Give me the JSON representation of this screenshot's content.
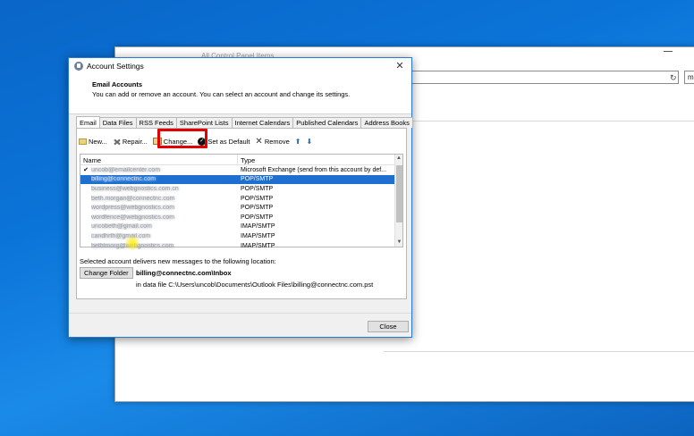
{
  "background_window": {
    "title": "All Control Panel Items",
    "search_text": "ma",
    "refresh_glyph": "↻"
  },
  "dialog": {
    "title": "Account Settings",
    "close_glyph": "✕",
    "header_title": "Email Accounts",
    "header_subtitle": "You can add or remove an account. You can select an account and change its settings.",
    "tabs": [
      {
        "label": "Email",
        "active": true
      },
      {
        "label": "Data Files",
        "active": false
      },
      {
        "label": "RSS Feeds",
        "active": false
      },
      {
        "label": "SharePoint Lists",
        "active": false
      },
      {
        "label": "Internet Calendars",
        "active": false
      },
      {
        "label": "Published Calendars",
        "active": false
      },
      {
        "label": "Address Books",
        "active": false
      }
    ],
    "toolbar": {
      "new_label": "New...",
      "repair_label": "Repair...",
      "change_label": "Change...",
      "set_default_label": "Set as Default",
      "remove_label": "Remove",
      "up_glyph": "⬆",
      "down_glyph": "⬇"
    },
    "list": {
      "col_name": "Name",
      "col_type": "Type",
      "rows": [
        {
          "name": "uncob@emailcenter.com",
          "type": "Microsoft Exchange (send from this account by def...",
          "default": true,
          "selected": false
        },
        {
          "name": "billing@connectnc.com",
          "type": "POP/SMTP",
          "default": false,
          "selected": true
        },
        {
          "name": "business@webgnostics.com.cn",
          "type": "POP/SMTP",
          "default": false,
          "selected": false
        },
        {
          "name": "beth.morgan@connectnc.com",
          "type": "POP/SMTP",
          "default": false,
          "selected": false
        },
        {
          "name": "wordpress@webgnostics.com",
          "type": "POP/SMTP",
          "default": false,
          "selected": false
        },
        {
          "name": "wordfence@webgnostics.com",
          "type": "POP/SMTP",
          "default": false,
          "selected": false
        },
        {
          "name": "uncobeth@gmail.com",
          "type": "IMAP/SMTP",
          "default": false,
          "selected": false
        },
        {
          "name": "candhrth@gmail.com",
          "type": "IMAP/SMTP",
          "default": false,
          "selected": false
        },
        {
          "name": "bethtmorg@webgnostics.com",
          "type": "IMAP/SMTP",
          "default": false,
          "selected": false
        }
      ]
    },
    "deliver_label": "Selected account delivers new messages to the following location:",
    "change_folder_label": "Change Folder",
    "folder_path": "billing@connectnc.com\\Inbox",
    "data_file": "in data file C:\\Users\\uncob\\Documents\\Outlook Files\\billing@connectnc.com.pst",
    "close_label": "Close"
  },
  "colors": {
    "selection": "#1f6fd1",
    "highlight_box": "#e20000",
    "desktop": "#0b74d8"
  }
}
